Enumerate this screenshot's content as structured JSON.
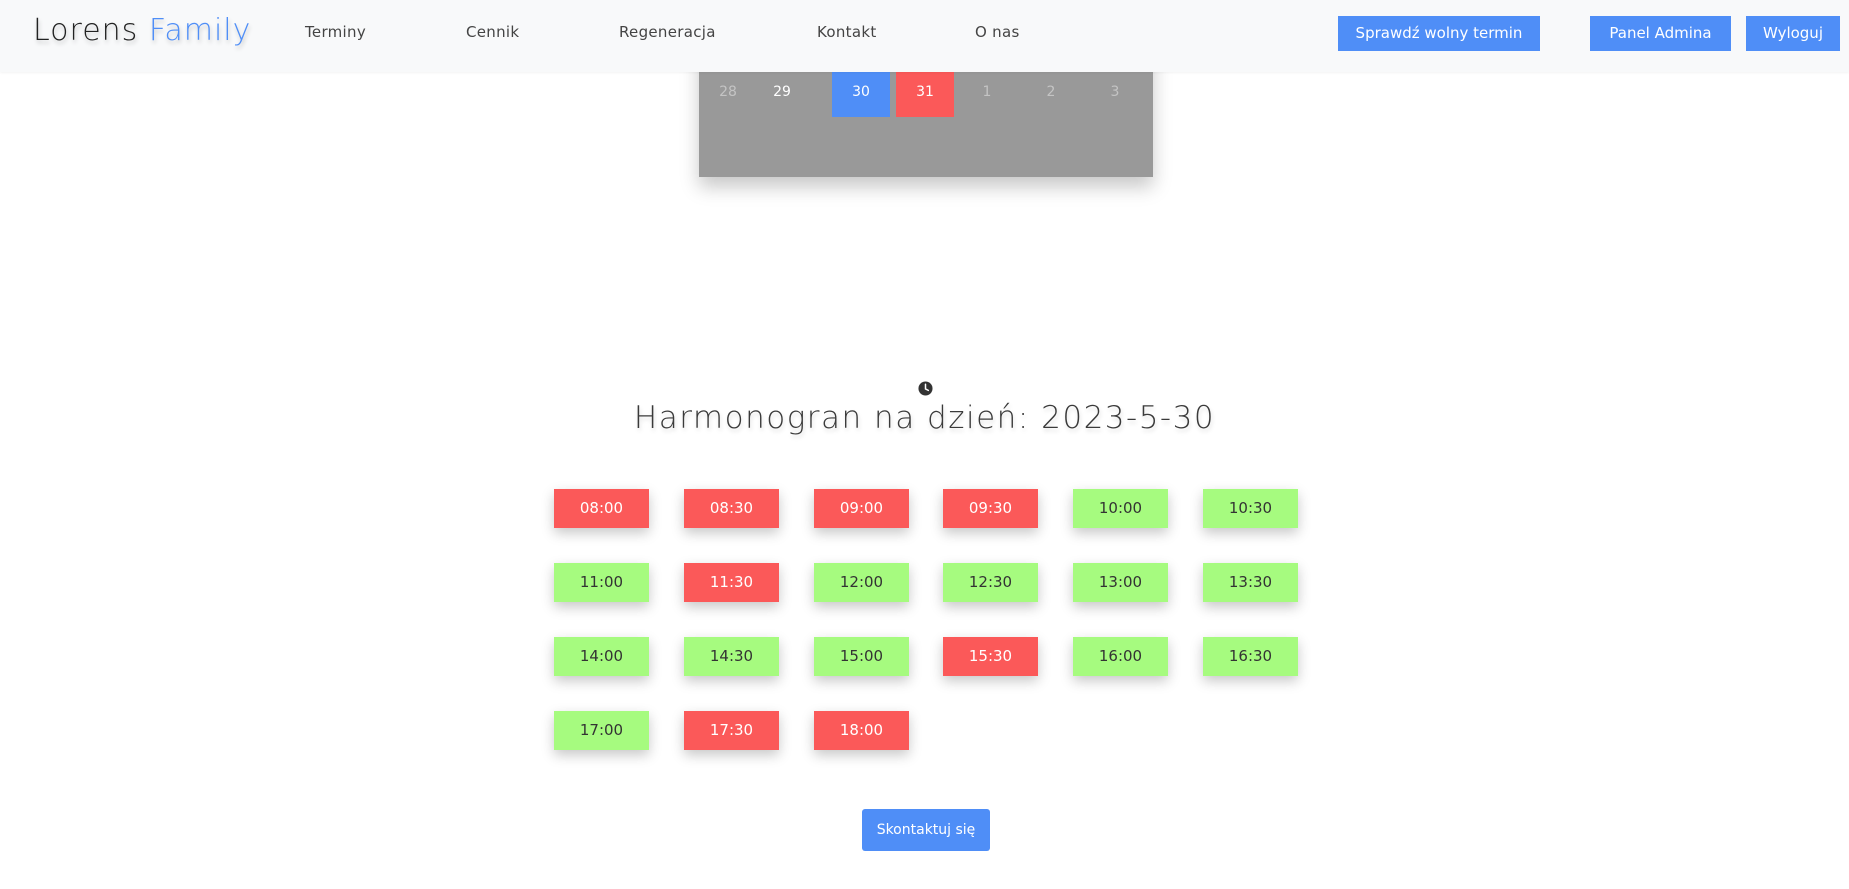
{
  "header": {
    "logo_main": "Lorens ",
    "logo_accent": "Family",
    "nav": [
      "Terminy",
      "Cennik",
      "Regeneracja",
      "Kontakt",
      "O nas"
    ],
    "check_button": "Sprawdź wolny termin",
    "admin_button": "Panel Admina",
    "logout_button": "Wyloguj"
  },
  "calendar": {
    "visible_row": [
      {
        "day": "28",
        "state": "muted"
      },
      {
        "day": "29",
        "state": "normal"
      },
      {
        "day": "30",
        "state": "selected"
      },
      {
        "day": "31",
        "state": "booked"
      },
      {
        "day": "1",
        "state": "muted"
      },
      {
        "day": "2",
        "state": "muted"
      },
      {
        "day": "3",
        "state": "muted"
      }
    ]
  },
  "schedule": {
    "title": "Harmonogran na dzień: 2023-5-30",
    "slots": [
      {
        "time": "08:00",
        "status": "taken"
      },
      {
        "time": "08:30",
        "status": "taken"
      },
      {
        "time": "09:00",
        "status": "taken"
      },
      {
        "time": "09:30",
        "status": "taken"
      },
      {
        "time": "10:00",
        "status": "free"
      },
      {
        "time": "10:30",
        "status": "free"
      },
      {
        "time": "11:00",
        "status": "free"
      },
      {
        "time": "11:30",
        "status": "taken"
      },
      {
        "time": "12:00",
        "status": "free"
      },
      {
        "time": "12:30",
        "status": "free"
      },
      {
        "time": "13:00",
        "status": "free"
      },
      {
        "time": "13:30",
        "status": "free"
      },
      {
        "time": "14:00",
        "status": "free"
      },
      {
        "time": "14:30",
        "status": "free"
      },
      {
        "time": "15:00",
        "status": "free"
      },
      {
        "time": "15:30",
        "status": "taken"
      },
      {
        "time": "16:00",
        "status": "free"
      },
      {
        "time": "16:30",
        "status": "free"
      },
      {
        "time": "17:00",
        "status": "free"
      },
      {
        "time": "17:30",
        "status": "taken"
      },
      {
        "time": "18:00",
        "status": "taken"
      }
    ],
    "contact_button": "Skontaktuj się"
  },
  "colors": {
    "accent_blue": "#4f8ef7",
    "free_slot": "#a6fb7f",
    "taken_slot": "#fb5959",
    "calendar_bg": "#999999"
  },
  "icons": {
    "schedule_icon": "clock-icon"
  }
}
